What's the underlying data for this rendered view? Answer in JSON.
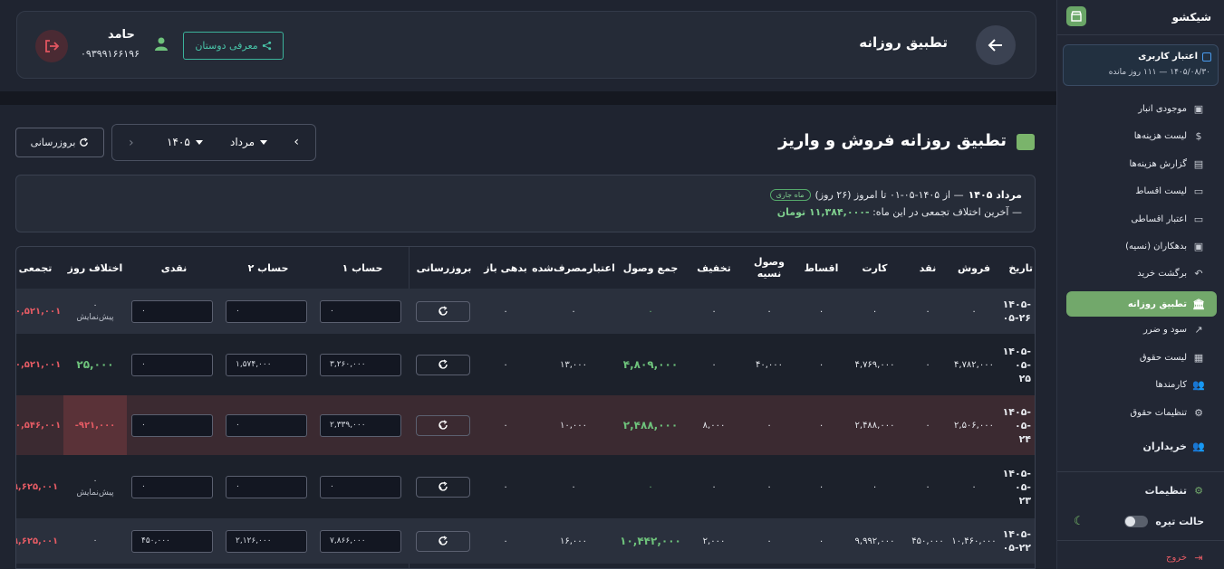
{
  "sidebar": {
    "brand": "شیکشو",
    "credit": {
      "title": "اعتبار کاربری",
      "subtitle": "۱۴۰۵/۰۸/۳۰ — ۱۱۱ روز مانده"
    },
    "items": [
      {
        "label": "موجودی انبار",
        "icon": "archive-icon",
        "glyph": "▣"
      },
      {
        "label": "لیست هزینه‌ها",
        "icon": "dollar-icon",
        "glyph": "$"
      },
      {
        "label": "گزارش هزینه‌ها",
        "icon": "report-icon",
        "glyph": "▤"
      },
      {
        "label": "لیست اقساط",
        "icon": "card-icon",
        "glyph": "▭"
      },
      {
        "label": "اعتبار اقساطی",
        "icon": "card-icon",
        "glyph": "▭"
      },
      {
        "label": "بدهکاران (نسیه)",
        "icon": "wallet-icon",
        "glyph": "▣"
      },
      {
        "label": "برگشت خرید",
        "icon": "undo-icon",
        "glyph": "↶"
      },
      {
        "label": "تطبیق روزانه",
        "icon": "bank-icon",
        "glyph": "🏛"
      },
      {
        "label": "سود و ضرر",
        "icon": "trend-icon",
        "glyph": "↗"
      },
      {
        "label": "لیست حقوق",
        "icon": "badge-icon",
        "glyph": "▦"
      },
      {
        "label": "کارمندها",
        "icon": "people-icon",
        "glyph": "👥"
      },
      {
        "label": "تنظیمات حقوق",
        "icon": "gear-icon",
        "glyph": "⚙"
      },
      {
        "label": "خریداران",
        "icon": "people-icon",
        "glyph": "👥"
      }
    ],
    "settings": "تنظیمات",
    "dark_mode": "حالت تیره",
    "logout": "خروج"
  },
  "header": {
    "title": "تطبیق روزانه",
    "user_name": "حامد",
    "user_phone": "۰۹۳۹۹۱۶۶۱۹۶",
    "invite_label": "معرفی دوستان"
  },
  "page": {
    "title": "تطبیق روزانه فروش و واریز",
    "refresh_label": "بروزرسانی",
    "month": "مرداد",
    "year": "۱۴۰۵"
  },
  "summary": {
    "line1_bold": "مرداد ۱۴۰۵",
    "line1_rest": "— از ۱۴۰۵-۰۵-۰۱ تا امروز (۲۶ روز)",
    "badge": "ماه جاری",
    "line2_text": "— آخرین اختلاف تجمعی در این ماه:",
    "line2_value": "-۱۱,۳۸۴,۰۰۰ تومان"
  },
  "table": {
    "headers": [
      "تاریخ",
      "فروش",
      "نقد",
      "کارت",
      "اقساط",
      "وصول نسیه",
      "تخفیف",
      "جمع وصول",
      "اعتبارمصرف‌شده",
      "بدهی باز",
      "بروزرسانی",
      "حساب ۱",
      "حساب ۲",
      "نقدی",
      "اختلاف روز",
      "تجمعی"
    ],
    "rows": [
      {
        "date": "۱۴۰۵-\n۰۵-۲۶",
        "sale": "۰",
        "cash": "۰",
        "card": "۰",
        "inst": "۰",
        "collect": "۰",
        "discount": "۰",
        "total": "۰",
        "credit": "۰",
        "debt": "۰",
        "acc1": "۰",
        "acc2": "۰",
        "cashin": "۰",
        "diff": "۰",
        "diff_note": "پیش‌نمایش",
        "cum": "۱۰,۵۲۱,۰۰۱"
      },
      {
        "date": "۱۴۰۵-\n۰۵-\n۲۵",
        "sale": "۴,۷۸۲,۰۰۰",
        "cash": "۰",
        "card": "۴,۷۶۹,۰۰۰",
        "inst": "۰",
        "collect": "۴۰,۰۰۰",
        "discount": "۰",
        "total": "۴,۸۰۹,۰۰۰",
        "credit": "۱۳,۰۰۰",
        "debt": "۰",
        "acc1": "۳,۲۶۰,۰۰۰",
        "acc2": "۱,۵۷۴,۰۰۰",
        "cashin": "۰",
        "diff": "۲۵,۰۰۰",
        "diff_note": "",
        "cum": "۱۰,۵۲۱,۰۰۱"
      },
      {
        "date": "۱۴۰۵-\n۰۵-\n۲۴",
        "sale": "۲,۵۰۶,۰۰۰",
        "cash": "۰",
        "card": "۲,۴۸۸,۰۰۰",
        "inst": "۰",
        "collect": "۰",
        "discount": "۸,۰۰۰",
        "total": "۲,۴۸۸,۰۰۰",
        "credit": "۱۰,۰۰۰",
        "debt": "۰",
        "acc1": "۲,۳۳۹,۰۰۰",
        "acc2": "۰",
        "cashin": "۰",
        "diff": "-۹۲۱,۰۰۰",
        "diff_note": "",
        "cum": "۱۰,۵۴۶,۰۰۱"
      },
      {
        "date": "۱۴۰۵-\n۰۵-\n۲۳",
        "sale": "۰",
        "cash": "۰",
        "card": "۰",
        "inst": "۰",
        "collect": "۰",
        "discount": "۰",
        "total": "۰",
        "credit": "۰",
        "debt": "۰",
        "acc1": "۰",
        "acc2": "۰",
        "cashin": "۰",
        "diff": "۰",
        "diff_note": "پیش‌نمایش",
        "cum": "۹,۶۲۵,۰۰۱"
      },
      {
        "date": "۱۴۰۵-\n۰۵-۲۲",
        "sale": "۱۰,۴۶۰,۰۰۰",
        "cash": "۴۵۰,۰۰۰",
        "card": "۹,۹۹۲,۰۰۰",
        "inst": "۰",
        "collect": "۰",
        "discount": "۲,۰۰۰",
        "total": "۱۰,۴۴۲,۰۰۰",
        "credit": "۱۶,۰۰۰",
        "debt": "۰",
        "acc1": "۷,۸۶۶,۰۰۰",
        "acc2": "۲,۱۲۶,۰۰۰",
        "cashin": "۴۵۰,۰۰۰",
        "diff": "۰",
        "diff_note": "",
        "cum": "۹,۶۲۵,۰۰۱"
      }
    ]
  },
  "colors": {
    "accent": "#72a86b",
    "negative": "#e45b64",
    "positive": "#6ec27b"
  }
}
